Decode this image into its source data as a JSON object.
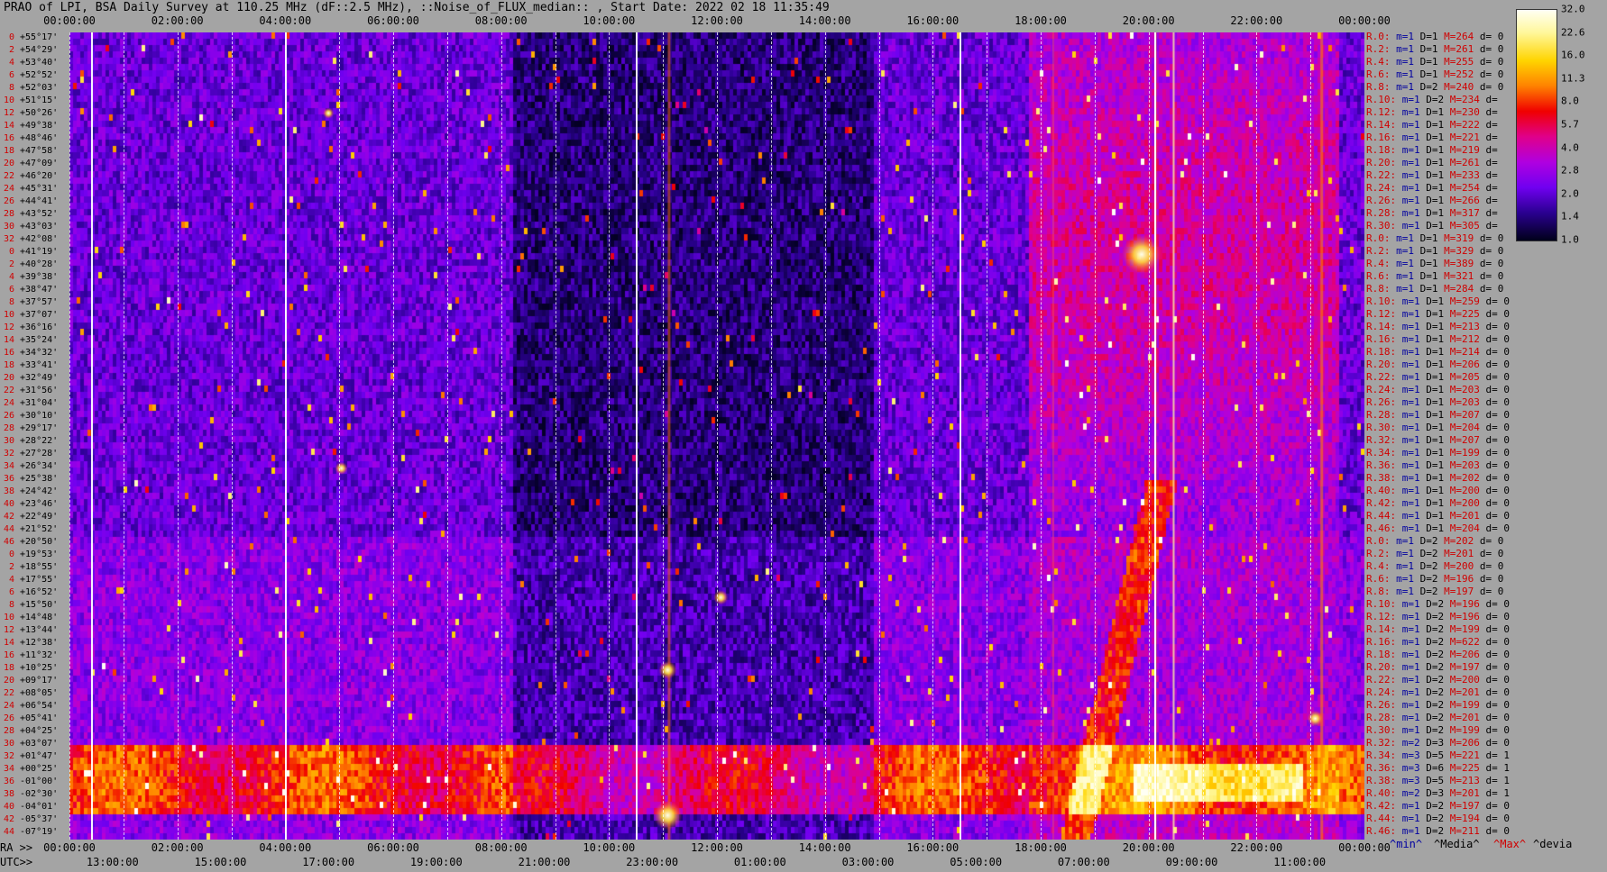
{
  "title": "PRAO of LPI, BSA Daily Survey at 110.25 MHz (dF::2.5 MHz), ::Noise_of_FLUX_median:: , Start Date: 2022 02 18 11:35:49",
  "top_ticks": [
    "00:00:00",
    "02:00:00",
    "04:00:00",
    "06:00:00",
    "08:00:00",
    "10:00:00",
    "12:00:00",
    "14:00:00",
    "16:00:00",
    "18:00:00",
    "20:00:00",
    "22:00:00",
    "00:00:00"
  ],
  "ra_label": "RA >>",
  "ra_ticks": [
    "00:00:00",
    "02:00:00",
    "04:00:00",
    "06:00:00",
    "08:00:00",
    "10:00:00",
    "12:00:00",
    "14:00:00",
    "16:00:00",
    "18:00:00",
    "20:00:00",
    "22:00:00",
    "00:00:00"
  ],
  "utc_label": "UTC>>",
  "utc_ticks": [
    "13:00:00",
    "15:00:00",
    "17:00:00",
    "19:00:00",
    "21:00:00",
    "23:00:00",
    "01:00:00",
    "03:00:00",
    "05:00:00",
    "07:00:00",
    "09:00:00",
    "11:00:00"
  ],
  "stats_labels": {
    "min": "^min^",
    "median": "^Media^",
    "max": "^Max^",
    "dev": "^devia"
  },
  "colorbar": {
    "ticks": [
      "32.0",
      "22.6",
      "16.0",
      "11.3",
      "8.0",
      "5.7",
      "4.0",
      "2.8",
      "2.0",
      "1.4",
      "1.0"
    ]
  },
  "declinations": [
    {
      "n": "0",
      "dec": "+55°17'"
    },
    {
      "n": "2",
      "dec": "+54°29'"
    },
    {
      "n": "4",
      "dec": "+53°40'"
    },
    {
      "n": "6",
      "dec": "+52°52'"
    },
    {
      "n": "8",
      "dec": "+52°03'"
    },
    {
      "n": "10",
      "dec": "+51°15'"
    },
    {
      "n": "12",
      "dec": "+50°26'"
    },
    {
      "n": "14",
      "dec": "+49°38'"
    },
    {
      "n": "16",
      "dec": "+48°46'"
    },
    {
      "n": "18",
      "dec": "+47°58'"
    },
    {
      "n": "20",
      "dec": "+47°09'"
    },
    {
      "n": "22",
      "dec": "+46°20'"
    },
    {
      "n": "24",
      "dec": "+45°31'"
    },
    {
      "n": "26",
      "dec": "+44°41'"
    },
    {
      "n": "28",
      "dec": "+43°52'"
    },
    {
      "n": "30",
      "dec": "+43°03'"
    },
    {
      "n": "32",
      "dec": "+42°08'"
    },
    {
      "n": "0",
      "dec": "+41°19'"
    },
    {
      "n": "2",
      "dec": "+40°28'"
    },
    {
      "n": "4",
      "dec": "+39°38'"
    },
    {
      "n": "6",
      "dec": "+38°47'"
    },
    {
      "n": "8",
      "dec": "+37°57'"
    },
    {
      "n": "10",
      "dec": "+37°07'"
    },
    {
      "n": "12",
      "dec": "+36°16'"
    },
    {
      "n": "14",
      "dec": "+35°24'"
    },
    {
      "n": "16",
      "dec": "+34°32'"
    },
    {
      "n": "18",
      "dec": "+33°41'"
    },
    {
      "n": "20",
      "dec": "+32°49'"
    },
    {
      "n": "22",
      "dec": "+31°56'"
    },
    {
      "n": "24",
      "dec": "+31°04'"
    },
    {
      "n": "26",
      "dec": "+30°10'"
    },
    {
      "n": "28",
      "dec": "+29°17'"
    },
    {
      "n": "30",
      "dec": "+28°22'"
    },
    {
      "n": "32",
      "dec": "+27°28'"
    },
    {
      "n": "34",
      "dec": "+26°34'"
    },
    {
      "n": "36",
      "dec": "+25°38'"
    },
    {
      "n": "38",
      "dec": "+24°42'"
    },
    {
      "n": "40",
      "dec": "+23°46'"
    },
    {
      "n": "42",
      "dec": "+22°49'"
    },
    {
      "n": "44",
      "dec": "+21°52'"
    },
    {
      "n": "46",
      "dec": "+20°50'"
    },
    {
      "n": "0",
      "dec": "+19°53'"
    },
    {
      "n": "2",
      "dec": "+18°55'"
    },
    {
      "n": "4",
      "dec": "+17°55'"
    },
    {
      "n": "6",
      "dec": "+16°52'"
    },
    {
      "n": "8",
      "dec": "+15°50'"
    },
    {
      "n": "10",
      "dec": "+14°48'"
    },
    {
      "n": "12",
      "dec": "+13°44'"
    },
    {
      "n": "14",
      "dec": "+12°38'"
    },
    {
      "n": "16",
      "dec": "+11°32'"
    },
    {
      "n": "18",
      "dec": "+10°25'"
    },
    {
      "n": "20",
      "dec": "+09°17'"
    },
    {
      "n": "22",
      "dec": "+08°05'"
    },
    {
      "n": "24",
      "dec": "+06°54'"
    },
    {
      "n": "26",
      "dec": "+05°41'"
    },
    {
      "n": "28",
      "dec": "+04°25'"
    },
    {
      "n": "30",
      "dec": "+03°07'"
    },
    {
      "n": "32",
      "dec": "+01°47'"
    },
    {
      "n": "34",
      "dec": "+00°25'"
    },
    {
      "n": "36",
      "dec": "-01°00'"
    },
    {
      "n": "38",
      "dec": "-02°30'"
    },
    {
      "n": "40",
      "dec": "-04°01'"
    },
    {
      "n": "42",
      "dec": "-05°37'"
    },
    {
      "n": "44",
      "dec": "-07°19'"
    }
  ],
  "beams": [
    {
      "r": "R.0:",
      "m": "m=1",
      "d": "D=1",
      "mx": "M=264",
      "dv": "d= 0"
    },
    {
      "r": "R.2:",
      "m": "m=1",
      "d": "D=1",
      "mx": "M=261",
      "dv": "d= 0"
    },
    {
      "r": "R.4:",
      "m": "m=1",
      "d": "D=1",
      "mx": "M=255",
      "dv": "d= 0"
    },
    {
      "r": "R.6:",
      "m": "m=1",
      "d": "D=1",
      "mx": "M=252",
      "dv": "d= 0"
    },
    {
      "r": "R.8:",
      "m": "m=1",
      "d": "D=2",
      "mx": "M=240",
      "dv": "d= 0"
    },
    {
      "r": "R.10:",
      "m": "m=1",
      "d": "D=2",
      "mx": "M=234",
      "dv": "d="
    },
    {
      "r": "R.12:",
      "m": "m=1",
      "d": "D=1",
      "mx": "M=230",
      "dv": "d="
    },
    {
      "r": "R.14:",
      "m": "m=1",
      "d": "D=1",
      "mx": "M=222",
      "dv": "d="
    },
    {
      "r": "R.16:",
      "m": "m=1",
      "d": "D=1",
      "mx": "M=221",
      "dv": "d="
    },
    {
      "r": "R.18:",
      "m": "m=1",
      "d": "D=1",
      "mx": "M=219",
      "dv": "d="
    },
    {
      "r": "R.20:",
      "m": "m=1",
      "d": "D=1",
      "mx": "M=261",
      "dv": "d="
    },
    {
      "r": "R.22:",
      "m": "m=1",
      "d": "D=1",
      "mx": "M=233",
      "dv": "d="
    },
    {
      "r": "R.24:",
      "m": "m=1",
      "d": "D=1",
      "mx": "M=254",
      "dv": "d="
    },
    {
      "r": "R.26:",
      "m": "m=1",
      "d": "D=1",
      "mx": "M=266",
      "dv": "d="
    },
    {
      "r": "R.28:",
      "m": "m=1",
      "d": "D=1",
      "mx": "M=317",
      "dv": "d="
    },
    {
      "r": "R.30:",
      "m": "m=1",
      "d": "D=1",
      "mx": "M=305",
      "dv": "d="
    },
    {
      "r": "R.0:",
      "m": "m=1",
      "d": "D=1",
      "mx": "M=319",
      "dv": "d= 0"
    },
    {
      "r": "R.2:",
      "m": "m=1",
      "d": "D=1",
      "mx": "M=329",
      "dv": "d= 0"
    },
    {
      "r": "R.4:",
      "m": "m=1",
      "d": "D=1",
      "mx": "M=389",
      "dv": "d= 0"
    },
    {
      "r": "R.6:",
      "m": "m=1",
      "d": "D=1",
      "mx": "M=321",
      "dv": "d= 0"
    },
    {
      "r": "R.8:",
      "m": "m=1",
      "d": "D=1",
      "mx": "M=284",
      "dv": "d= 0"
    },
    {
      "r": "R.10:",
      "m": "m=1",
      "d": "D=1",
      "mx": "M=259",
      "dv": "d= 0"
    },
    {
      "r": "R.12:",
      "m": "m=1",
      "d": "D=1",
      "mx": "M=225",
      "dv": "d= 0"
    },
    {
      "r": "R.14:",
      "m": "m=1",
      "d": "D=1",
      "mx": "M=213",
      "dv": "d= 0"
    },
    {
      "r": "R.16:",
      "m": "m=1",
      "d": "D=1",
      "mx": "M=212",
      "dv": "d= 0"
    },
    {
      "r": "R.18:",
      "m": "m=1",
      "d": "D=1",
      "mx": "M=214",
      "dv": "d= 0"
    },
    {
      "r": "R.20:",
      "m": "m=1",
      "d": "D=1",
      "mx": "M=206",
      "dv": "d= 0"
    },
    {
      "r": "R.22:",
      "m": "m=1",
      "d": "D=1",
      "mx": "M=205",
      "dv": "d= 0"
    },
    {
      "r": "R.24:",
      "m": "m=1",
      "d": "D=1",
      "mx": "M=203",
      "dv": "d= 0"
    },
    {
      "r": "R.26:",
      "m": "m=1",
      "d": "D=1",
      "mx": "M=203",
      "dv": "d= 0"
    },
    {
      "r": "R.28:",
      "m": "m=1",
      "d": "D=1",
      "mx": "M=207",
      "dv": "d= 0"
    },
    {
      "r": "R.30:",
      "m": "m=1",
      "d": "D=1",
      "mx": "M=204",
      "dv": "d= 0"
    },
    {
      "r": "R.32:",
      "m": "m=1",
      "d": "D=1",
      "mx": "M=207",
      "dv": "d= 0"
    },
    {
      "r": "R.34:",
      "m": "m=1",
      "d": "D=1",
      "mx": "M=199",
      "dv": "d= 0"
    },
    {
      "r": "R.36:",
      "m": "m=1",
      "d": "D=1",
      "mx": "M=203",
      "dv": "d= 0"
    },
    {
      "r": "R.38:",
      "m": "m=1",
      "d": "D=1",
      "mx": "M=202",
      "dv": "d= 0"
    },
    {
      "r": "R.40:",
      "m": "m=1",
      "d": "D=1",
      "mx": "M=200",
      "dv": "d= 0"
    },
    {
      "r": "R.42:",
      "m": "m=1",
      "d": "D=1",
      "mx": "M=200",
      "dv": "d= 0"
    },
    {
      "r": "R.44:",
      "m": "m=1",
      "d": "D=1",
      "mx": "M=201",
      "dv": "d= 0"
    },
    {
      "r": "R.46:",
      "m": "m=1",
      "d": "D=1",
      "mx": "M=204",
      "dv": "d= 0"
    },
    {
      "r": "R.0:",
      "m": "m=1",
      "d": "D=2",
      "mx": "M=202",
      "dv": "d= 0"
    },
    {
      "r": "R.2:",
      "m": "m=1",
      "d": "D=2",
      "mx": "M=201",
      "dv": "d= 0"
    },
    {
      "r": "R.4:",
      "m": "m=1",
      "d": "D=2",
      "mx": "M=200",
      "dv": "d= 0"
    },
    {
      "r": "R.6:",
      "m": "m=1",
      "d": "D=2",
      "mx": "M=196",
      "dv": "d= 0"
    },
    {
      "r": "R.8:",
      "m": "m=1",
      "d": "D=2",
      "mx": "M=197",
      "dv": "d= 0"
    },
    {
      "r": "R.10:",
      "m": "m=1",
      "d": "D=2",
      "mx": "M=196",
      "dv": "d= 0"
    },
    {
      "r": "R.12:",
      "m": "m=1",
      "d": "D=2",
      "mx": "M=196",
      "dv": "d= 0"
    },
    {
      "r": "R.14:",
      "m": "m=1",
      "d": "D=2",
      "mx": "M=199",
      "dv": "d= 0"
    },
    {
      "r": "R.16:",
      "m": "m=1",
      "d": "D=2",
      "mx": "M=622",
      "dv": "d= 0"
    },
    {
      "r": "R.18:",
      "m": "m=1",
      "d": "D=2",
      "mx": "M=206",
      "dv": "d= 0"
    },
    {
      "r": "R.20:",
      "m": "m=1",
      "d": "D=2",
      "mx": "M=197",
      "dv": "d= 0"
    },
    {
      "r": "R.22:",
      "m": "m=1",
      "d": "D=2",
      "mx": "M=200",
      "dv": "d= 0"
    },
    {
      "r": "R.24:",
      "m": "m=1",
      "d": "D=2",
      "mx": "M=201",
      "dv": "d= 0"
    },
    {
      "r": "R.26:",
      "m": "m=1",
      "d": "D=2",
      "mx": "M=199",
      "dv": "d= 0"
    },
    {
      "r": "R.28:",
      "m": "m=1",
      "d": "D=2",
      "mx": "M=201",
      "dv": "d= 0"
    },
    {
      "r": "R.30:",
      "m": "m=1",
      "d": "D=2",
      "mx": "M=199",
      "dv": "d= 0"
    },
    {
      "r": "R.32:",
      "m": "m=2",
      "d": "D=3",
      "mx": "M=206",
      "dv": "d= 0"
    },
    {
      "r": "R.34:",
      "m": "m=3",
      "d": "D=5",
      "mx": "M=221",
      "dv": "d= 1"
    },
    {
      "r": "R.36:",
      "m": "m=3",
      "d": "D=6",
      "mx": "M=225",
      "dv": "d= 1"
    },
    {
      "r": "R.38:",
      "m": "m=3",
      "d": "D=5",
      "mx": "M=213",
      "dv": "d= 1"
    },
    {
      "r": "R.40:",
      "m": "m=2",
      "d": "D=3",
      "mx": "M=201",
      "dv": "d= 1"
    },
    {
      "r": "R.42:",
      "m": "m=1",
      "d": "D=2",
      "mx": "M=197",
      "dv": "d= 0"
    },
    {
      "r": "R.44:",
      "m": "m=1",
      "d": "D=2",
      "mx": "M=194",
      "dv": "d= 0"
    },
    {
      "r": "R.46:",
      "m": "m=1",
      "d": "D=2",
      "mx": "M=211",
      "dv": "d= 0"
    }
  ],
  "chart_data": {
    "type": "heatmap",
    "title": "PRAO of LPI, BSA Daily Survey at 110.25 MHz (dF::2.5 MHz), ::Noise_of_FLUX_median:: , Start Date: 2022 02 18 11:35:49",
    "x_axis_top": [
      "00:00:00",
      "02:00:00",
      "04:00:00",
      "06:00:00",
      "08:00:00",
      "10:00:00",
      "12:00:00",
      "14:00:00",
      "16:00:00",
      "18:00:00",
      "20:00:00",
      "22:00:00",
      "00:00:00"
    ],
    "x_axis_ra": [
      "00:00:00",
      "02:00:00",
      "04:00:00",
      "06:00:00",
      "08:00:00",
      "10:00:00",
      "12:00:00",
      "14:00:00",
      "16:00:00",
      "18:00:00",
      "20:00:00",
      "22:00:00",
      "00:00:00"
    ],
    "x_axis_utc": [
      "13:00:00",
      "15:00:00",
      "17:00:00",
      "19:00:00",
      "21:00:00",
      "23:00:00",
      "01:00:00",
      "03:00:00",
      "05:00:00",
      "07:00:00",
      "09:00:00",
      "11:00:00"
    ],
    "y_axis_declination_range": [
      "+55°17'",
      "-07°19'"
    ],
    "colorscale_range": [
      1.0,
      32.0
    ],
    "colorscale_ticks": [
      32.0,
      22.6,
      16.0,
      11.3,
      8.0,
      5.7,
      4.0,
      2.8,
      2.0,
      1.4,
      1.0
    ],
    "grid": true,
    "features": {
      "bright_band_declinations": [
        "+01°47'",
        "-02°30'"
      ],
      "bright_source_ra_hours": [
        11.9,
        20.0,
        23.3
      ]
    }
  }
}
